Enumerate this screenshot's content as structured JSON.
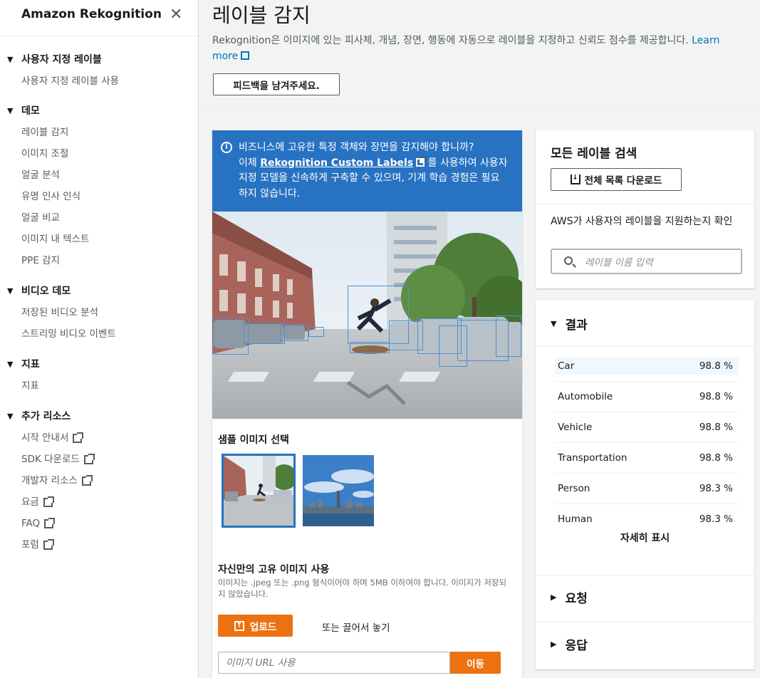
{
  "sidebar": {
    "brand": "Amazon Rekognition",
    "sections": [
      {
        "title": "사용자 지정 레이블",
        "items": [
          {
            "label": "사용자 지정 레이블 사용",
            "external": false
          }
        ]
      },
      {
        "title": "데모",
        "items": [
          {
            "label": "레이블 감지",
            "external": false
          },
          {
            "label": "이미지 조절",
            "external": false
          },
          {
            "label": "얼굴 분석",
            "external": false
          },
          {
            "label": "유명 인사 인식",
            "external": false
          },
          {
            "label": "얼굴 비교",
            "external": false
          },
          {
            "label": "이미지 내 텍스트",
            "external": false
          },
          {
            "label": "PPE 감지",
            "external": false
          }
        ]
      },
      {
        "title": "비디오 데모",
        "items": [
          {
            "label": "저장된 비디오 분석",
            "external": false
          },
          {
            "label": "스트리밍 비디오 이벤트",
            "external": false
          }
        ]
      },
      {
        "title": "지표",
        "items": [
          {
            "label": "지표",
            "external": false
          }
        ]
      },
      {
        "title": "추가 리소스",
        "items": [
          {
            "label": "시작 안내서",
            "external": true
          },
          {
            "label": "SDK 다운로드",
            "external": true
          },
          {
            "label": "개발자 리소스",
            "external": true
          },
          {
            "label": "요금",
            "external": true
          },
          {
            "label": "FAQ",
            "external": true
          },
          {
            "label": "포럼",
            "external": true
          }
        ]
      }
    ]
  },
  "header": {
    "title": "레이블 감지",
    "description": "Rekognition은 이미지에 있는 피사체, 개념, 장면, 행동에 자동으로 레이블을 지정하고 신뢰도 점수를 제공합니다.",
    "learn_more": "Learn more",
    "feedback_button": "피드백을 남겨주세요."
  },
  "banner": {
    "line1": "비즈니스에 고유한 특정 객체와 장면을 감지해야 합니까?",
    "line2_pre": "이제",
    "link": "Rekognition Custom Labels",
    "line2_post": "를 사용하여 사용자 지정 모델을 신속하게 구축할 수 있으며, 기계 학습 경험은 필요하지 않습니다."
  },
  "samples": {
    "title": "샘플 이미지 선택"
  },
  "own_image": {
    "title": "자신만의 고유 이미지 사용",
    "desc": "이미지는 .jpeg 또는 .png 형식이어야 하며 5MB 이하여야 합니다. 이미지가 저장되지 않았습니다.",
    "upload_button": "업로드",
    "drag_text": "또는 끌어서 놓기",
    "url_placeholder": "이미지 URL 사용",
    "go_button": "이동"
  },
  "search_panel": {
    "title": "모든 레이블 검색",
    "download_button": "전체 목록 다운로드",
    "hint": "AWS가 사용자의 레이블을 지원하는지 확인",
    "placeholder": "레이블 이름 입력"
  },
  "results": {
    "title": "결과",
    "rows": [
      {
        "label": "Car",
        "score": "98.8 %"
      },
      {
        "label": "Automobile",
        "score": "98.8 %"
      },
      {
        "label": "Vehicle",
        "score": "98.8 %"
      },
      {
        "label": "Transportation",
        "score": "98.8 %"
      },
      {
        "label": "Person",
        "score": "98.3 %"
      },
      {
        "label": "Human",
        "score": "98.3 %"
      }
    ],
    "more": "자세히 표시",
    "request": "요청",
    "response": "응답"
  },
  "colors": {
    "accent": "#ec7211",
    "banner": "#2872c2",
    "link": "#0073bb"
  }
}
